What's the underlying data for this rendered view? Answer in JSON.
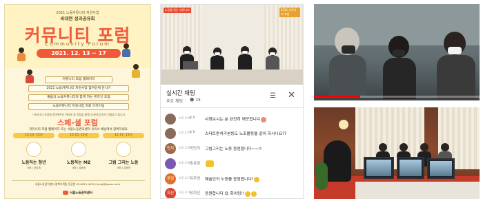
{
  "poster": {
    "org_line": "2021 노동커뮤니티 지원사업",
    "subtitle": "비대면 성과공유회",
    "title": "커뮤니티 포럼",
    "title_eng": "Community Forum",
    "date": "2021. 12. 13 ~ 17",
    "boxes": [
      "커뮤니티 포럼 웹페이지",
      "2021 노동커뮤니티 지원사업 참여단체 만나기",
      "돌봄의 노동커뮤니티와 함께 하는 온라인 포럼",
      "노동커뮤니티 지원사업 자료 아카이빙"
    ],
    "note": "* 커뮤니티 포럼에 참여해주신 여러분 중 추첨을 통해 20분께 감사의 선물을 드립니다",
    "special_title": "스페-셜 포럼",
    "special_sub": "커뮤니티 포럼 웹페이지 또는 서울노동권익센터 유튜브 채널에서 참여하세요",
    "sessions": [
      {
        "day": "12.14. 15시",
        "name": "노동하는 청년",
        "desc": "사회 | 공감제"
      },
      {
        "day": "12.15. 15시",
        "name": "노동하는 MZ",
        "desc": "사회 | 김윤호"
      },
      {
        "day": "12.17. 15시",
        "name": "그림 그리는 노동",
        "desc": "사회 | 김혜진"
      }
    ],
    "footer": "서울노동권익센터 정책기획팀 윤공현 02-6012-4050 | help@labors.or.kr",
    "center_name": "서울노동권익센터"
  },
  "chat": {
    "video_banner": "노동을 잇는 커뮤니티",
    "video_banner2": "2021 커뮤니티 포럼",
    "title": "실시간 채팅",
    "subtitle": "주요 채팅",
    "viewer_count": "15",
    "filter_icon": "sliders-icon",
    "close_icon": "close-icon",
    "messages": [
      {
        "avatar_text": "",
        "avatar_color": "#8a6a5a",
        "time": "오후 3:56",
        "author": "k k",
        "text": "사회보시는 분 완전히 깨끗합니다"
      },
      {
        "avatar_text": "",
        "avatar_color": "#8a6a5a",
        "time": "오후 3:41",
        "author": "k k",
        "text": "스타트톤처가본동도 노조활동을 같이 하시나요??"
      },
      {
        "avatar_text": "민지",
        "avatar_color": "#9e6a4a",
        "time": "오후 3:59",
        "author": "이민지",
        "text": "그림그리는 노동 응원합니다~~!!"
      },
      {
        "avatar_text": "",
        "avatar_color": "#7a5ab0",
        "time": "오후 4:00",
        "author": "송유림",
        "text": ""
      },
      {
        "avatar_text": "주영",
        "avatar_color": "#e0702a",
        "time": "오후 4:11",
        "author": "이주영",
        "text": "예술인의 노동을 응원합니다!"
      },
      {
        "avatar_text": "희선",
        "avatar_color": "#d8442e",
        "time": "오후 4:16",
        "author": "성희선",
        "text": "응원합니다 😊 화이팅!!"
      }
    ]
  },
  "video_player": {
    "progress_fraction": 0.28,
    "progress_color": "#ff0000"
  }
}
